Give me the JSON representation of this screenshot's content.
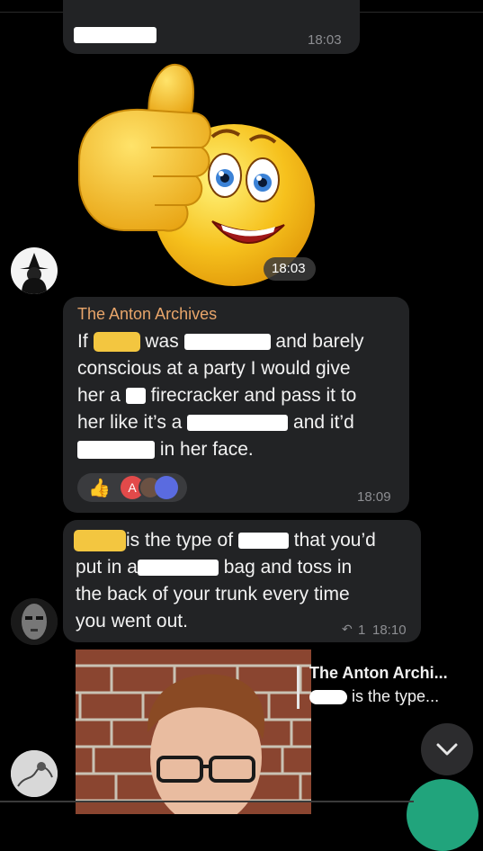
{
  "messages": {
    "m1": {
      "time": "18:03"
    },
    "sticker": {
      "time": "18:03"
    },
    "m2": {
      "sender": "The Anton Archives",
      "line1_a": "If",
      "line1_b": "was",
      "line1_c": "and barely",
      "line2": "conscious at a party I would give",
      "line3_a": "her a",
      "line3_b": "firecracker and pass it to",
      "line4_a": "her like it’s a",
      "line4_b": "and it’d",
      "line5": "in her face.",
      "time": "18:09",
      "reactions": {
        "thumb": "👍",
        "a_label": "A"
      }
    },
    "m3": {
      "line1_a": "is the type of",
      "line1_b": "that you’d",
      "line2_a": "put in a",
      "line2_b": "bag and toss in",
      "line3": "the back of your trunk every time",
      "line4": "you went out.",
      "reply_count": "1",
      "time": "18:10"
    },
    "m4": {
      "reply_sender": "The Anton Archi...",
      "reply_text": "is the type..."
    }
  },
  "colors": {
    "background": "#000000",
    "bubble": "#222325",
    "sender": "#e8a56a",
    "timestamp": "#8d8e92",
    "redact_yellow": "#f3c640"
  }
}
